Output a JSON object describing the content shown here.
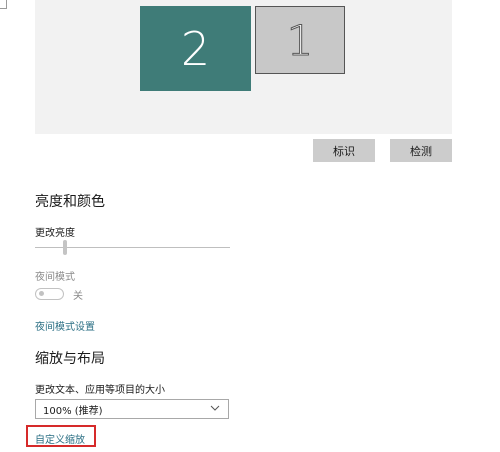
{
  "display": {
    "monitor_2_label": "2",
    "monitor_1_label": "1",
    "identify_label": "标识",
    "detect_label": "检测"
  },
  "brightness": {
    "section_title": "亮度和颜色",
    "change_brightness_label": "更改亮度",
    "brightness_value_fraction": 0.15,
    "night_mode_label": "夜间模式",
    "night_mode_state": "关",
    "night_mode_settings_link": "夜间模式设置"
  },
  "scale_layout": {
    "section_title": "缩放与布局",
    "text_size_label": "更改文本、应用等项目的大小",
    "scale_selected": "100% (推荐)",
    "custom_scale_link": "自定义缩放"
  },
  "colors": {
    "monitor_active": "#3f7c78",
    "monitor_inactive": "#c8c8c8",
    "link": "#2b6f84",
    "highlight_box": "#d62a2a"
  }
}
